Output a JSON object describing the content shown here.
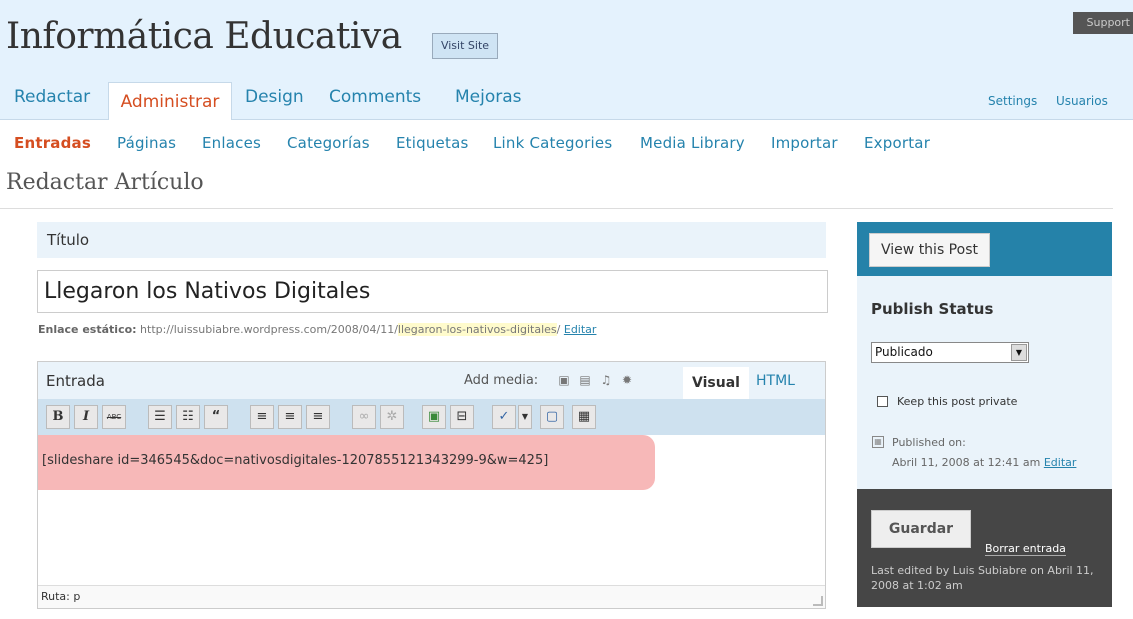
{
  "header": {
    "site_title": "Informática Educativa",
    "visit_site": "Visit Site",
    "support": "Support"
  },
  "main_nav": {
    "tabs": [
      "Redactar",
      "Administrar",
      "Design",
      "Comments",
      "Mejoras"
    ],
    "active_tab": "Administrar",
    "right_links": [
      "Settings",
      "Usuarios"
    ]
  },
  "sub_nav": {
    "items": [
      "Entradas",
      "Páginas",
      "Enlaces",
      "Categorías",
      "Etiquetas",
      "Link Categories",
      "Media Library",
      "Importar",
      "Exportar"
    ],
    "current": "Entradas"
  },
  "page": {
    "title": "Redactar Artículo"
  },
  "title_box": {
    "header": "Título",
    "value": "Llegaron los Nativos Digitales"
  },
  "permalink": {
    "label": "Enlace estático:",
    "base": "http://luissubiabre.wordpress.com/2008/04/11/",
    "slug": "llegaron-los-nativos-digitales",
    "trail": "/",
    "edit": "Editar"
  },
  "editor": {
    "label": "Entrada",
    "add_media": "Add media:",
    "visual_tab": "Visual",
    "html_tab": "HTML",
    "content": "[slideshare id=346545&doc=nativosdigitales-1207855121343299-9&w=425]",
    "path": "Ruta: p",
    "toolbar": {
      "bold": "B",
      "italic": "I",
      "strike": "ABC",
      "quote": "“"
    }
  },
  "sidebar": {
    "view_post": "View this Post",
    "publish_status": "Publish Status",
    "status_value": "Publicado",
    "keep_private": "Keep this post private",
    "published_on_label": "Published on:",
    "published_date": "Abril 11, 2008 at 12:41 am",
    "published_edit": "Editar",
    "save": "Guardar",
    "delete": "Borrar entrada",
    "last_edited": "Last edited by Luis Subiabre on Abril 11, 2008 at 1:02 am"
  },
  "colors": {
    "header_bg": "#e4f2fd",
    "link": "#2583ad",
    "active": "#d54e21",
    "highlight": "#f7b8b8",
    "sidebar_blue": "#2582a9",
    "sidebar_dark": "#464646"
  }
}
